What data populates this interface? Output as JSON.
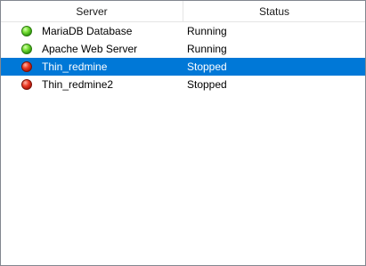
{
  "columns": {
    "server": "Server",
    "status": "Status"
  },
  "colors": {
    "selection": "#0078d7",
    "running": "#2f9a0c",
    "stopped": "#d0200f"
  },
  "rows": [
    {
      "name": "MariaDB Database",
      "status": "Running",
      "icon": "green-status-icon",
      "selected": false
    },
    {
      "name": "Apache Web Server",
      "status": "Running",
      "icon": "green-status-icon",
      "selected": false
    },
    {
      "name": "Thin_redmine",
      "status": "Stopped",
      "icon": "red-status-icon",
      "selected": true
    },
    {
      "name": "Thin_redmine2",
      "status": "Stopped",
      "icon": "red-status-icon",
      "selected": false
    }
  ]
}
